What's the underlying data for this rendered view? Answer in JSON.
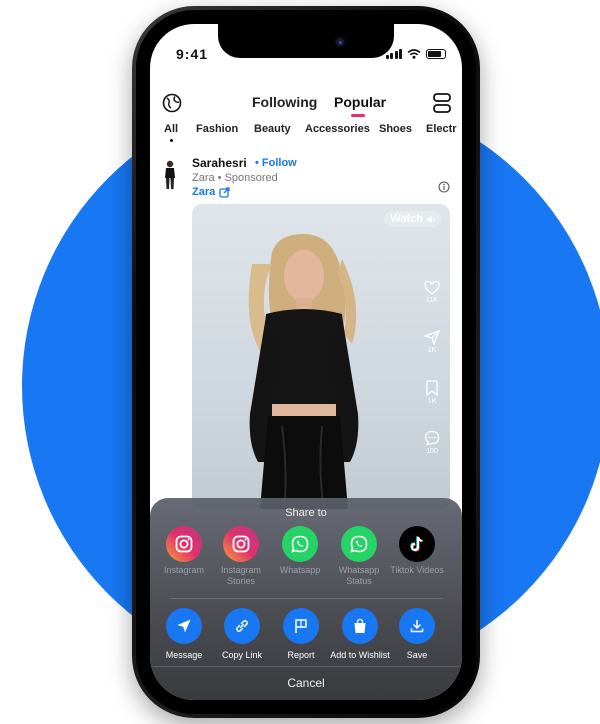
{
  "status": {
    "time": "9:41"
  },
  "feed_tabs": [
    "Following",
    "Popular"
  ],
  "categories": [
    "All",
    "Fashion",
    "Beauty",
    "Accessories",
    "Shoes",
    "Electr"
  ],
  "post": {
    "author": "Sarahesri",
    "follow_label": "• Follow",
    "subtitle": "Zara • Sponsored",
    "brand_link": "Zara",
    "watch_label": "Watch",
    "stats": {
      "likes": "11K",
      "shares": "1K",
      "saves": "1K",
      "comments": "100"
    }
  },
  "share_sheet": {
    "title": "Share to",
    "targets": [
      {
        "label": "Instagram",
        "icon": "instagram-icon",
        "color": "#e1306c"
      },
      {
        "label": "Instagram Stories",
        "icon": "instagram-icon",
        "color": "#e1306c"
      },
      {
        "label": "Whatsapp",
        "icon": "whatsapp-icon",
        "color": "#25d366"
      },
      {
        "label": "Whatsapp Status",
        "icon": "whatsapp-icon",
        "color": "#25d366"
      },
      {
        "label": "Tiktok Videos",
        "icon": "tiktok-icon",
        "color": "#000000"
      }
    ],
    "actions": [
      {
        "label": "Message",
        "icon": "send-icon"
      },
      {
        "label": "Copy Link",
        "icon": "link-icon"
      },
      {
        "label": "Report",
        "icon": "flag-icon"
      },
      {
        "label": "Add to Wishlist",
        "icon": "shopping-bag-icon"
      },
      {
        "label": "Save",
        "icon": "download-icon"
      }
    ],
    "cancel_label": "Cancel"
  },
  "colors": {
    "accent": "#1877f2",
    "tab_indicator": "#e1306c",
    "background_circle": "#1877f2"
  }
}
